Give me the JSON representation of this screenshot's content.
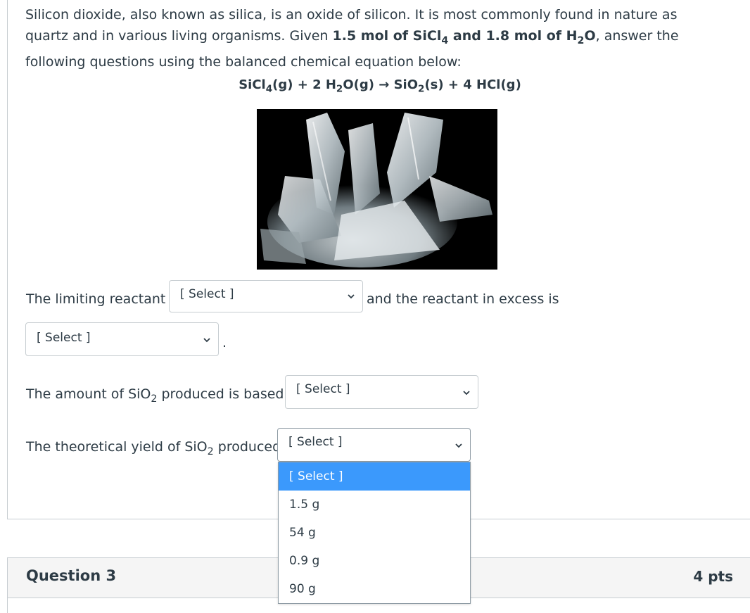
{
  "intro": {
    "part1": "Silicon dioxide, also known as silica, is an oxide of silicon. It is most commonly found in nature as quartz and in various living organisms. Given ",
    "given": "1.5 mol of SiCl",
    "given_sub": "4",
    "given2": " and 1.8 mol of H",
    "given2_sub": "2",
    "given3": "O",
    "part2": ", answer the following questions using the balanced chemical equation below:"
  },
  "equation": {
    "a": "SiCl",
    "a_sub": "4",
    "b": "(g) + 2 H",
    "b_sub": "2",
    "c": "O(g) → SiO",
    "c_sub": "2",
    "d": "(s) + 4 HCl(g)"
  },
  "image": {
    "icon": "quartz-crystal-photo"
  },
  "q_limiting": {
    "prefix": "The limiting reactant is",
    "select_label": "[ Select ]",
    "suffix": "and the reactant in excess is",
    "select2_label": "[ Select ]",
    "end": "."
  },
  "q_based": {
    "prefix": "The amount of SiO",
    "prefix_sub": "2",
    "prefix2": " produced is based on",
    "select_label": "[ Select ]"
  },
  "q_yield": {
    "prefix": "The theoretical yield of SiO",
    "prefix_sub": "2",
    "prefix2": " produced is",
    "select_label": "[ Select ]",
    "options": [
      "[ Select ]",
      "1.5 g",
      "54 g",
      "0.9 g",
      "90 g"
    ]
  },
  "question3": {
    "title": "Question 3",
    "points": "4 pts"
  },
  "colors": {
    "highlight": "#3b99fc",
    "text": "#2d3b45",
    "border": "#c7cdd1"
  }
}
